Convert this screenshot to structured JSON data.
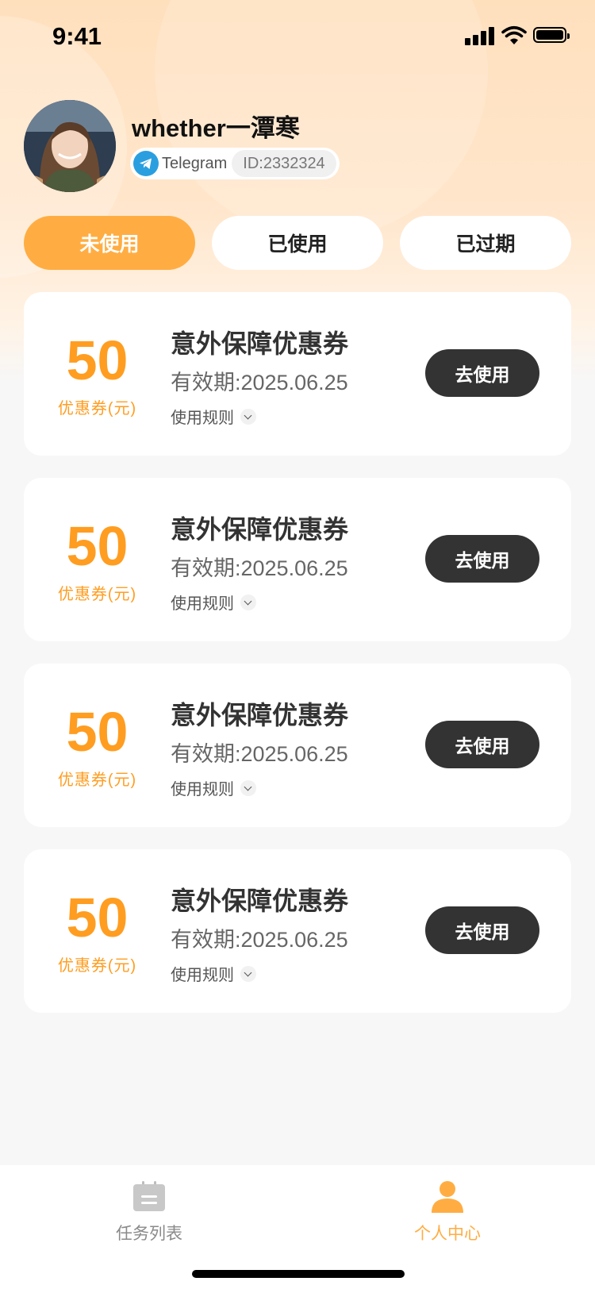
{
  "status_bar": {
    "time": "9:41"
  },
  "profile": {
    "username": "whether一潭寒",
    "platform": "Telegram",
    "user_id": "ID:2332324"
  },
  "tabs": [
    {
      "label": "未使用",
      "active": true
    },
    {
      "label": "已使用",
      "active": false
    },
    {
      "label": "已过期",
      "active": false
    }
  ],
  "coupons": [
    {
      "amount": "50",
      "unit": "优惠券(元)",
      "title": "意外保障优惠券",
      "validity": "有效期:2025.06.25",
      "rule_label": "使用规则",
      "button": "去使用"
    },
    {
      "amount": "50",
      "unit": "优惠券(元)",
      "title": "意外保障优惠券",
      "validity": "有效期:2025.06.25",
      "rule_label": "使用规则",
      "button": "去使用"
    },
    {
      "amount": "50",
      "unit": "优惠券(元)",
      "title": "意外保障优惠券",
      "validity": "有效期:2025.06.25",
      "rule_label": "使用规则",
      "button": "去使用"
    },
    {
      "amount": "50",
      "unit": "优惠券(元)",
      "title": "意外保障优惠券",
      "validity": "有效期:2025.06.25",
      "rule_label": "使用规则",
      "button": "去使用"
    }
  ],
  "bottom_nav": [
    {
      "label": "任务列表",
      "icon": "task-list-icon",
      "active": false
    },
    {
      "label": "个人中心",
      "icon": "person-icon",
      "active": true
    }
  ],
  "colors": {
    "accent": "#ffad42",
    "amount": "#ff9d21",
    "button_dark": "#333333",
    "header_bg": "#ffe0bd"
  }
}
